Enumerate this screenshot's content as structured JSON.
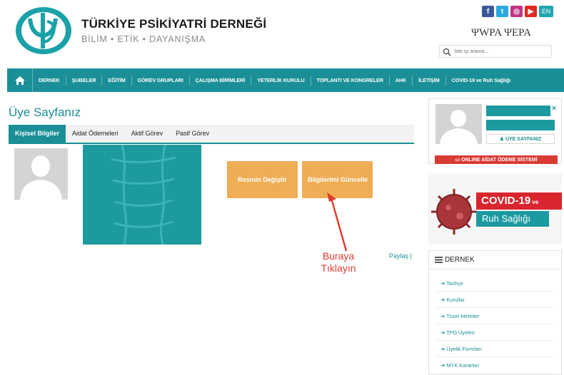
{
  "header": {
    "title": "TÜRKİYE PSİKİYATRİ DERNEĞİ",
    "subtitle": "BİLİM • ETİK • DAYANIŞMA",
    "social": [
      {
        "name": "facebook-icon",
        "glyph": "f",
        "color": "#3b5998"
      },
      {
        "name": "twitter-icon",
        "glyph": "t",
        "color": "#2aa9e0"
      },
      {
        "name": "instagram-icon",
        "glyph": "◎",
        "color": "#c13584"
      },
      {
        "name": "youtube-icon",
        "glyph": "▶",
        "color": "#e02a20"
      }
    ],
    "lang": "EN",
    "partners": "ΨWPA ΨEPA",
    "search_placeholder": "Site içi arama..."
  },
  "nav": {
    "items": [
      "DERNEK",
      "ŞUBELER",
      "EĞİTİM",
      "GÖREV GRUPLARI",
      "ÇALIŞMA BİRİMLERİ",
      "YETERLİK KURULU",
      "TOPLANTI VE KONGRELER",
      "AHK",
      "İLETİŞİM",
      "COVID-19 ve Ruh Sağlığı"
    ]
  },
  "main": {
    "title": "Üye Sayfanız",
    "tabs": [
      "Kişisel Bilgiler",
      "Aidat Ödemeleri",
      "Aktif Görev",
      "Pasif Görev"
    ],
    "btn_photo": "Resmin Değiştir",
    "btn_update": "Bilgilerimi Güncelle",
    "annotation": [
      "Buraya",
      "Tıklayın"
    ],
    "share": "Paylaş |"
  },
  "sidebar": {
    "close": "×",
    "profile_btn": "♟ ÜYE SAYFANIZ",
    "pay_btn": "▭ ONLINE AİDAT ÖDEME SİSTEMİ",
    "covid_l1": "COVID-19",
    "covid_l1_small": " ve",
    "covid_l2": "Ruh Sağlığı",
    "dernek_title": "DERNEK",
    "dernek_items": [
      "➜ Tarihçe",
      "➜ Kurullar",
      "➜ Tüzel Metinler",
      "➜ TPD Üyeleri",
      "➜ Üyelik Formları",
      "➜ MYK Kararları"
    ]
  },
  "colors": {
    "teal": "#1b8f97",
    "orange": "#efae55",
    "red": "#e03a2b"
  }
}
